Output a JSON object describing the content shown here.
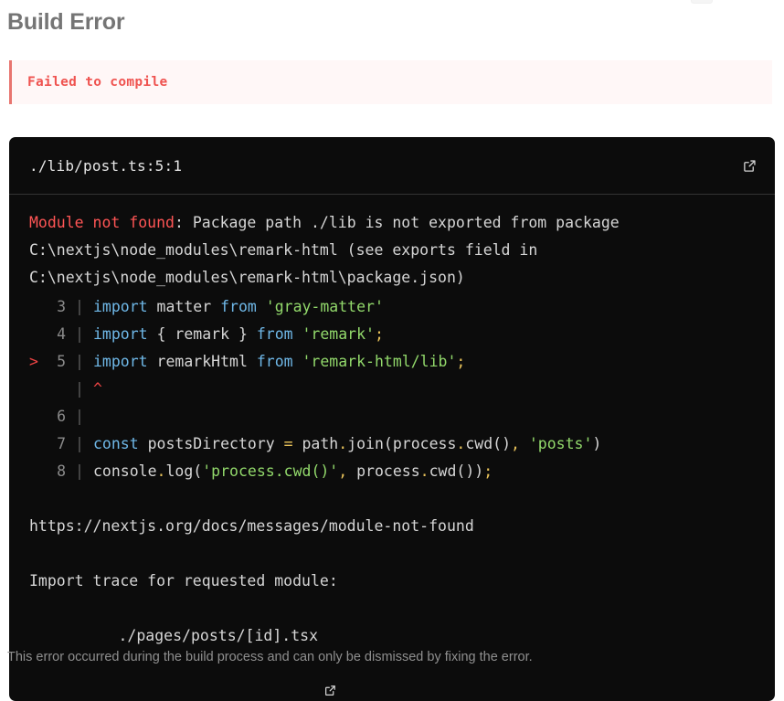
{
  "overlay": {
    "title": "Build Error",
    "banner": {
      "text": "Failed to compile",
      "accent_color": "#e8756f",
      "background_color": "#fff7f7",
      "text_color": "#ef5350"
    },
    "footer_note": "This error occurred during the build process and can only be dismissed by fixing the error."
  },
  "code_panel": {
    "file_location": "./lib/post.ts:5:1",
    "open_in_editor_icon": "external-link-icon",
    "background_color": "#0c0c0c",
    "message": {
      "head": "Module not found",
      "rest": ": Package path ./lib is not exported from package C:\\nextjs\\node_modules\\remark-html (see exports field in C:\\nextjs\\node_modules\\remark-html\\package.json)"
    },
    "code_lines": [
      {
        "marker": "",
        "number": "3",
        "tokens": [
          {
            "text": "import ",
            "type": "keyword"
          },
          {
            "text": "matter ",
            "type": "plain"
          },
          {
            "text": "from ",
            "type": "keyword"
          },
          {
            "text": "'gray-matter'",
            "type": "string"
          }
        ]
      },
      {
        "marker": "",
        "number": "4",
        "tokens": [
          {
            "text": "import ",
            "type": "keyword"
          },
          {
            "text": "{ remark } ",
            "type": "plain"
          },
          {
            "text": "from ",
            "type": "keyword"
          },
          {
            "text": "'remark'",
            "type": "string"
          },
          {
            "text": ";",
            "type": "punct"
          }
        ]
      },
      {
        "marker": ">",
        "number": "5",
        "tokens": [
          {
            "text": "import ",
            "type": "keyword"
          },
          {
            "text": "remarkHtml ",
            "type": "plain"
          },
          {
            "text": "from ",
            "type": "keyword"
          },
          {
            "text": "'remark-html/lib'",
            "type": "string"
          },
          {
            "text": ";",
            "type": "punct"
          }
        ]
      },
      {
        "marker": "",
        "number": "",
        "tokens": [
          {
            "text": "^",
            "type": "caret"
          }
        ]
      },
      {
        "marker": "",
        "number": "6",
        "tokens": []
      },
      {
        "marker": "",
        "number": "7",
        "tokens": [
          {
            "text": "const ",
            "type": "keyword"
          },
          {
            "text": "postsDirectory ",
            "type": "plain"
          },
          {
            "text": "=",
            "type": "punct"
          },
          {
            "text": " path",
            "type": "plain"
          },
          {
            "text": ".",
            "type": "punct"
          },
          {
            "text": "join(process",
            "type": "plain"
          },
          {
            "text": ".",
            "type": "punct"
          },
          {
            "text": "cwd()",
            "type": "plain"
          },
          {
            "text": ",",
            "type": "punct"
          },
          {
            "text": " ",
            "type": "plain"
          },
          {
            "text": "'posts'",
            "type": "string"
          },
          {
            "text": ")",
            "type": "plain"
          }
        ]
      },
      {
        "marker": "",
        "number": "8",
        "tokens": [
          {
            "text": "console",
            "type": "plain"
          },
          {
            "text": ".",
            "type": "punct"
          },
          {
            "text": "log(",
            "type": "plain"
          },
          {
            "text": "'process.cwd()'",
            "type": "string"
          },
          {
            "text": ",",
            "type": "punct"
          },
          {
            "text": " process",
            "type": "plain"
          },
          {
            "text": ".",
            "type": "punct"
          },
          {
            "text": "cwd())",
            "type": "plain"
          },
          {
            "text": ";",
            "type": "punct"
          }
        ]
      }
    ],
    "docs_url": "https://nextjs.org/docs/messages/module-not-found",
    "import_trace_label": "Import trace for requested module:",
    "import_trace_files": [
      {
        "path": "./pages/posts/[id].tsx",
        "icon": "external-link-icon"
      }
    ]
  }
}
